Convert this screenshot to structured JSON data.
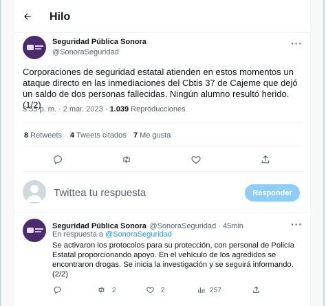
{
  "header": {
    "title": "Hilo",
    "back_icon": "arrow-left-icon"
  },
  "tweet": {
    "author_name": "Seguridad Pública Sonora",
    "author_handle": "@SonoraSeguridad",
    "text": "Corporaciones de seguridad estatal atienden en estos momentos un ataque directo en las inmediaciones del Cbtis 37 de Cajeme que dejó un saldo de dos personas fallecidas. Ningún alumno resultó herido. (1/2)",
    "time": "5:55 p. m. · 2 mar. 2023 · ",
    "views_count": "1.039",
    "views_label": " Reproducciones",
    "retweets_count": "8",
    "retweets_label": " Retweets",
    "quotes_count": "4",
    "quotes_label": " Tweets citados",
    "likes_count": "7",
    "likes_label": " Me gusta"
  },
  "compose": {
    "placeholder": "Twittea tu respuesta",
    "button_label": "Responder"
  },
  "reply": {
    "author_name": "Seguridad Pública Sonora",
    "author_handle": "@SonoraSeguridad · 45min",
    "reply_to_prefix": "En respuesta a ",
    "reply_to_handle": "@SonoraSeguridad",
    "text": "Se activaron los protocolos para su protección, con personal de Policía Estatal proporcionando apoyo. En el vehículo de los agredidos se encontraron drogas. Se inicia la investigación y se seguirá informando. (2/2)",
    "retweet_count": "2",
    "like_count": "2",
    "views_count": "257"
  },
  "colors": {
    "accent": "#1d9bf0",
    "button_disabled": "#8ecdf8",
    "avatar": "#4b2a6e"
  }
}
